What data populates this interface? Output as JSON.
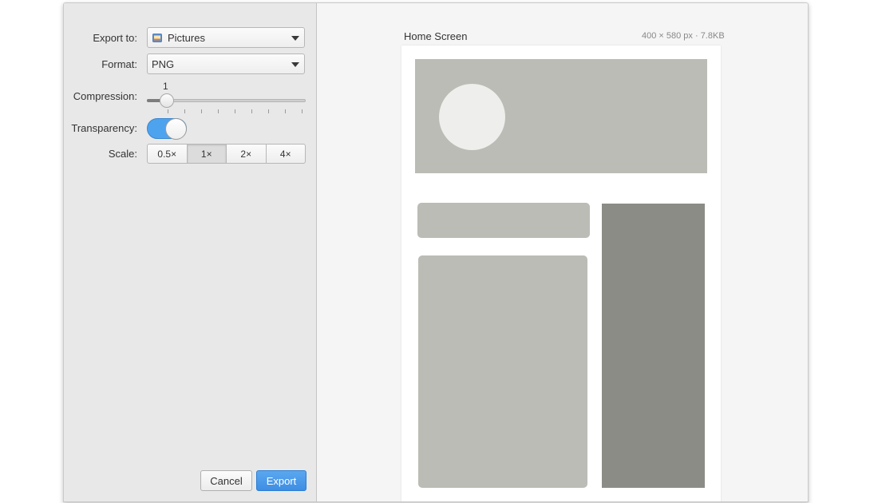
{
  "sidebar": {
    "export_to": {
      "label": "Export to:",
      "value": "Pictures",
      "icon": "folder-pictures-icon"
    },
    "format": {
      "label": "Format:",
      "value": "PNG"
    },
    "compression": {
      "label": "Compression:",
      "value": "1"
    },
    "transparency": {
      "label": "Transparency:",
      "enabled": true
    },
    "scale": {
      "label": "Scale:",
      "options": [
        "0.5×",
        "1×",
        "2×",
        "4×"
      ],
      "selected": "1×"
    },
    "buttons": {
      "cancel": "Cancel",
      "export": "Export"
    }
  },
  "preview": {
    "title": "Home Screen",
    "meta": "400 × 580 px · 7.8KB"
  },
  "colors": {
    "accent": "#3d8de3",
    "toggle_on": "#4ea3ef",
    "placeholder_light": "#babcb5",
    "placeholder_dark": "#8b8c86",
    "placeholder_circle": "#eeeeec"
  }
}
